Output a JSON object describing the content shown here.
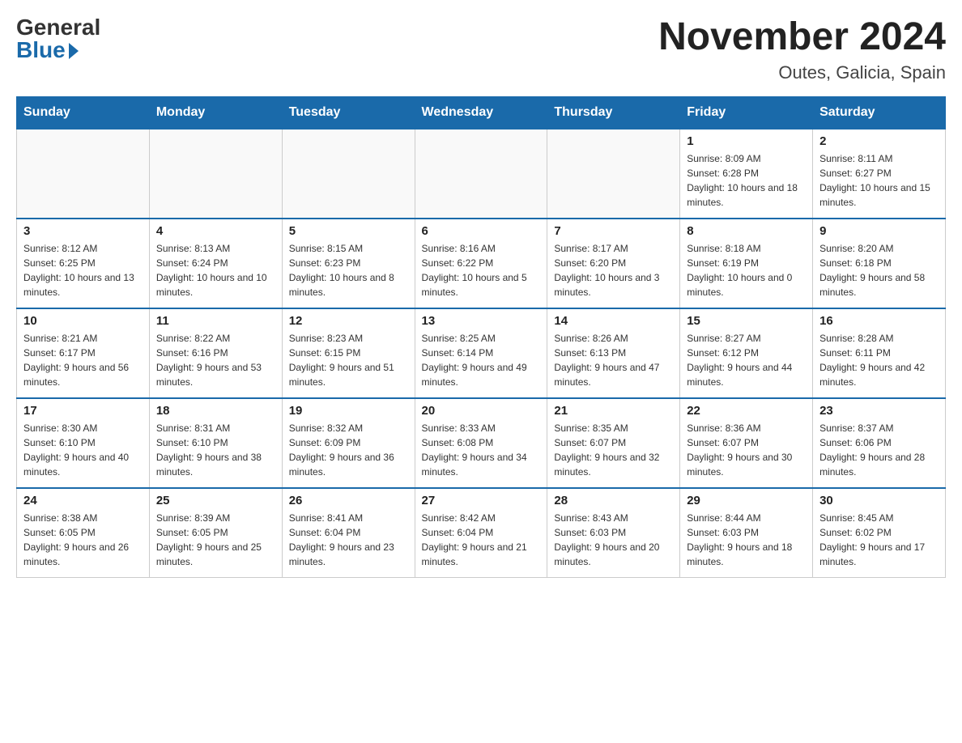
{
  "logo": {
    "general": "General",
    "blue": "Blue"
  },
  "title": "November 2024",
  "location": "Outes, Galicia, Spain",
  "days_of_week": [
    "Sunday",
    "Monday",
    "Tuesday",
    "Wednesday",
    "Thursday",
    "Friday",
    "Saturday"
  ],
  "weeks": [
    [
      {
        "day": "",
        "sunrise": "",
        "sunset": "",
        "daylight": ""
      },
      {
        "day": "",
        "sunrise": "",
        "sunset": "",
        "daylight": ""
      },
      {
        "day": "",
        "sunrise": "",
        "sunset": "",
        "daylight": ""
      },
      {
        "day": "",
        "sunrise": "",
        "sunset": "",
        "daylight": ""
      },
      {
        "day": "",
        "sunrise": "",
        "sunset": "",
        "daylight": ""
      },
      {
        "day": "1",
        "sunrise": "Sunrise: 8:09 AM",
        "sunset": "Sunset: 6:28 PM",
        "daylight": "Daylight: 10 hours and 18 minutes."
      },
      {
        "day": "2",
        "sunrise": "Sunrise: 8:11 AM",
        "sunset": "Sunset: 6:27 PM",
        "daylight": "Daylight: 10 hours and 15 minutes."
      }
    ],
    [
      {
        "day": "3",
        "sunrise": "Sunrise: 8:12 AM",
        "sunset": "Sunset: 6:25 PM",
        "daylight": "Daylight: 10 hours and 13 minutes."
      },
      {
        "day": "4",
        "sunrise": "Sunrise: 8:13 AM",
        "sunset": "Sunset: 6:24 PM",
        "daylight": "Daylight: 10 hours and 10 minutes."
      },
      {
        "day": "5",
        "sunrise": "Sunrise: 8:15 AM",
        "sunset": "Sunset: 6:23 PM",
        "daylight": "Daylight: 10 hours and 8 minutes."
      },
      {
        "day": "6",
        "sunrise": "Sunrise: 8:16 AM",
        "sunset": "Sunset: 6:22 PM",
        "daylight": "Daylight: 10 hours and 5 minutes."
      },
      {
        "day": "7",
        "sunrise": "Sunrise: 8:17 AM",
        "sunset": "Sunset: 6:20 PM",
        "daylight": "Daylight: 10 hours and 3 minutes."
      },
      {
        "day": "8",
        "sunrise": "Sunrise: 8:18 AM",
        "sunset": "Sunset: 6:19 PM",
        "daylight": "Daylight: 10 hours and 0 minutes."
      },
      {
        "day": "9",
        "sunrise": "Sunrise: 8:20 AM",
        "sunset": "Sunset: 6:18 PM",
        "daylight": "Daylight: 9 hours and 58 minutes."
      }
    ],
    [
      {
        "day": "10",
        "sunrise": "Sunrise: 8:21 AM",
        "sunset": "Sunset: 6:17 PM",
        "daylight": "Daylight: 9 hours and 56 minutes."
      },
      {
        "day": "11",
        "sunrise": "Sunrise: 8:22 AM",
        "sunset": "Sunset: 6:16 PM",
        "daylight": "Daylight: 9 hours and 53 minutes."
      },
      {
        "day": "12",
        "sunrise": "Sunrise: 8:23 AM",
        "sunset": "Sunset: 6:15 PM",
        "daylight": "Daylight: 9 hours and 51 minutes."
      },
      {
        "day": "13",
        "sunrise": "Sunrise: 8:25 AM",
        "sunset": "Sunset: 6:14 PM",
        "daylight": "Daylight: 9 hours and 49 minutes."
      },
      {
        "day": "14",
        "sunrise": "Sunrise: 8:26 AM",
        "sunset": "Sunset: 6:13 PM",
        "daylight": "Daylight: 9 hours and 47 minutes."
      },
      {
        "day": "15",
        "sunrise": "Sunrise: 8:27 AM",
        "sunset": "Sunset: 6:12 PM",
        "daylight": "Daylight: 9 hours and 44 minutes."
      },
      {
        "day": "16",
        "sunrise": "Sunrise: 8:28 AM",
        "sunset": "Sunset: 6:11 PM",
        "daylight": "Daylight: 9 hours and 42 minutes."
      }
    ],
    [
      {
        "day": "17",
        "sunrise": "Sunrise: 8:30 AM",
        "sunset": "Sunset: 6:10 PM",
        "daylight": "Daylight: 9 hours and 40 minutes."
      },
      {
        "day": "18",
        "sunrise": "Sunrise: 8:31 AM",
        "sunset": "Sunset: 6:10 PM",
        "daylight": "Daylight: 9 hours and 38 minutes."
      },
      {
        "day": "19",
        "sunrise": "Sunrise: 8:32 AM",
        "sunset": "Sunset: 6:09 PM",
        "daylight": "Daylight: 9 hours and 36 minutes."
      },
      {
        "day": "20",
        "sunrise": "Sunrise: 8:33 AM",
        "sunset": "Sunset: 6:08 PM",
        "daylight": "Daylight: 9 hours and 34 minutes."
      },
      {
        "day": "21",
        "sunrise": "Sunrise: 8:35 AM",
        "sunset": "Sunset: 6:07 PM",
        "daylight": "Daylight: 9 hours and 32 minutes."
      },
      {
        "day": "22",
        "sunrise": "Sunrise: 8:36 AM",
        "sunset": "Sunset: 6:07 PM",
        "daylight": "Daylight: 9 hours and 30 minutes."
      },
      {
        "day": "23",
        "sunrise": "Sunrise: 8:37 AM",
        "sunset": "Sunset: 6:06 PM",
        "daylight": "Daylight: 9 hours and 28 minutes."
      }
    ],
    [
      {
        "day": "24",
        "sunrise": "Sunrise: 8:38 AM",
        "sunset": "Sunset: 6:05 PM",
        "daylight": "Daylight: 9 hours and 26 minutes."
      },
      {
        "day": "25",
        "sunrise": "Sunrise: 8:39 AM",
        "sunset": "Sunset: 6:05 PM",
        "daylight": "Daylight: 9 hours and 25 minutes."
      },
      {
        "day": "26",
        "sunrise": "Sunrise: 8:41 AM",
        "sunset": "Sunset: 6:04 PM",
        "daylight": "Daylight: 9 hours and 23 minutes."
      },
      {
        "day": "27",
        "sunrise": "Sunrise: 8:42 AM",
        "sunset": "Sunset: 6:04 PM",
        "daylight": "Daylight: 9 hours and 21 minutes."
      },
      {
        "day": "28",
        "sunrise": "Sunrise: 8:43 AM",
        "sunset": "Sunset: 6:03 PM",
        "daylight": "Daylight: 9 hours and 20 minutes."
      },
      {
        "day": "29",
        "sunrise": "Sunrise: 8:44 AM",
        "sunset": "Sunset: 6:03 PM",
        "daylight": "Daylight: 9 hours and 18 minutes."
      },
      {
        "day": "30",
        "sunrise": "Sunrise: 8:45 AM",
        "sunset": "Sunset: 6:02 PM",
        "daylight": "Daylight: 9 hours and 17 minutes."
      }
    ]
  ]
}
